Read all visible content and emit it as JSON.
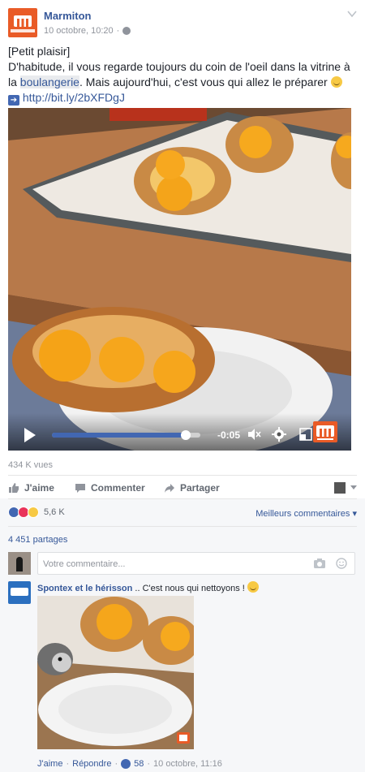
{
  "post": {
    "author": "Marmiton",
    "timestamp": "10 octobre, 10:20",
    "separator": "·",
    "text_line1": "[Petit plaisir]",
    "text_body_a": "D'habitude, il vous regarde toujours du coin de l'oeil dans la vitrine à la ",
    "text_highlight": "boulangerie",
    "text_body_b": ". Mais aujourd'hui, c'est vous qui allez le préparer",
    "link": "http://bit.ly/2bXFDgJ",
    "icons": {
      "avatar": "marmiton-logo",
      "privacy": "globe-icon",
      "menu": "chevron-down-icon",
      "emoji": "smiley-emoji",
      "link_arrow": "right-arrow-icon"
    }
  },
  "video": {
    "time_remaining": "-0:05",
    "progress": 0.9,
    "accent": "#4267b2",
    "icons": [
      "play-icon",
      "mute-icon",
      "gear-icon",
      "expand-icon",
      "marmiton-logo"
    ]
  },
  "stats": {
    "views": "434 K vues"
  },
  "actions": {
    "like": "J'aime",
    "comment": "Commenter",
    "share": "Partager"
  },
  "reactions": {
    "types": [
      "like",
      "love",
      "wow"
    ],
    "count": "5,6 K",
    "sort": "Meilleurs commentaires",
    "shares": "4 451 partages"
  },
  "composer": {
    "placeholder": "Votre commentaire..."
  },
  "comment": {
    "author": "Spontex et le hérisson",
    "text": " .. C'est nous qui nettoyons !",
    "like": "J'aime",
    "separator": "·",
    "reply": "Répondre",
    "likes": "58",
    "time": "10 octobre, 11:16"
  },
  "colors": {
    "link": "#365899",
    "brand": "#e95b27",
    "muted": "#90949c"
  }
}
